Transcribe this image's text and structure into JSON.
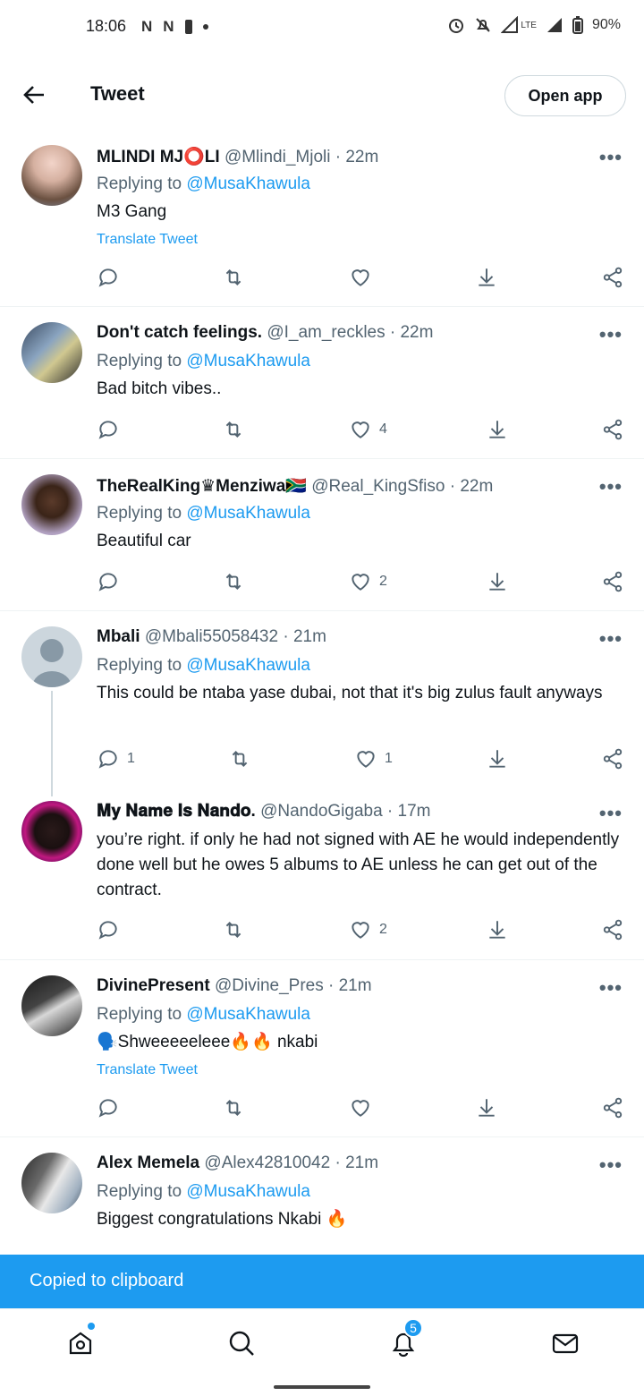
{
  "status_bar": {
    "time": "18:06",
    "left_icons": [
      "N",
      "N"
    ],
    "battery": "90%",
    "network": "LTE"
  },
  "header": {
    "title": "Tweet",
    "open_app_label": "Open app"
  },
  "reply_prefix": "Replying to",
  "translate_label": "Translate Tweet",
  "tweets": [
    {
      "name": "MLINDI MJ⭕LI",
      "handle": "@Mlindi_Mjoli · 22m",
      "reply_to": "@MusaKhawula",
      "text": "M3 Gang",
      "translate": true,
      "reply_count": "",
      "retweet_count": "",
      "like_count": ""
    },
    {
      "name": "Don't catch feelings.",
      "handle": "@I_am_reckles · 22m",
      "reply_to": "@MusaKhawula",
      "text": "Bad bitch vibes..",
      "translate": false,
      "reply_count": "",
      "retweet_count": "",
      "like_count": "4"
    },
    {
      "name": "TheRealKing♛Menziwa🇿🇦",
      "handle": "@Real_KingSfiso · 22m",
      "reply_to": "@MusaKhawula",
      "text": "Beautiful car",
      "translate": false,
      "reply_count": "",
      "retweet_count": "",
      "like_count": "2"
    },
    {
      "name": "Mbali",
      "handle": "@Mbali55058432 · 21m",
      "reply_to": "@MusaKhawula",
      "text": "This could be ntaba yase dubai, not that it's big zulus fault anyways",
      "translate": false,
      "reply_count": "1",
      "retweet_count": "",
      "like_count": "1"
    },
    {
      "name": "𝐌𝐲 𝐍𝐚𝐦𝐞 𝐈𝐬 𝐍𝐚𝐧𝐝𝐨.",
      "handle": "@NandoGigaba · 17m",
      "reply_to": "",
      "text": "you’re right. if only he had not signed with AE he would independently done well but he owes 5 albums to AE unless he can get out of the contract.",
      "translate": false,
      "reply_count": "",
      "retweet_count": "",
      "like_count": "2"
    },
    {
      "name": "DivinePresent",
      "handle": "@Divine_Pres · 21m",
      "reply_to": "@MusaKhawula",
      "text": "🗣️Shweeeeeleee🔥🔥 nkabi",
      "translate": true,
      "reply_count": "",
      "retweet_count": "",
      "like_count": ""
    },
    {
      "name": "Alex Memela",
      "handle": "@Alex42810042 · 21m",
      "reply_to": "@MusaKhawula",
      "text": "Biggest congratulations Nkabi 🔥",
      "translate": false,
      "reply_count": "",
      "retweet_count": "",
      "like_count": ""
    }
  ],
  "toast": "Copied to clipboard",
  "bottom_nav": {
    "notifications_badge": "5",
    "items": [
      "home-icon",
      "search-icon",
      "bell-icon",
      "mail-icon"
    ]
  },
  "colors": {
    "accent": "#1d9bf0",
    "text": "#0f1419",
    "muted": "#536471"
  }
}
